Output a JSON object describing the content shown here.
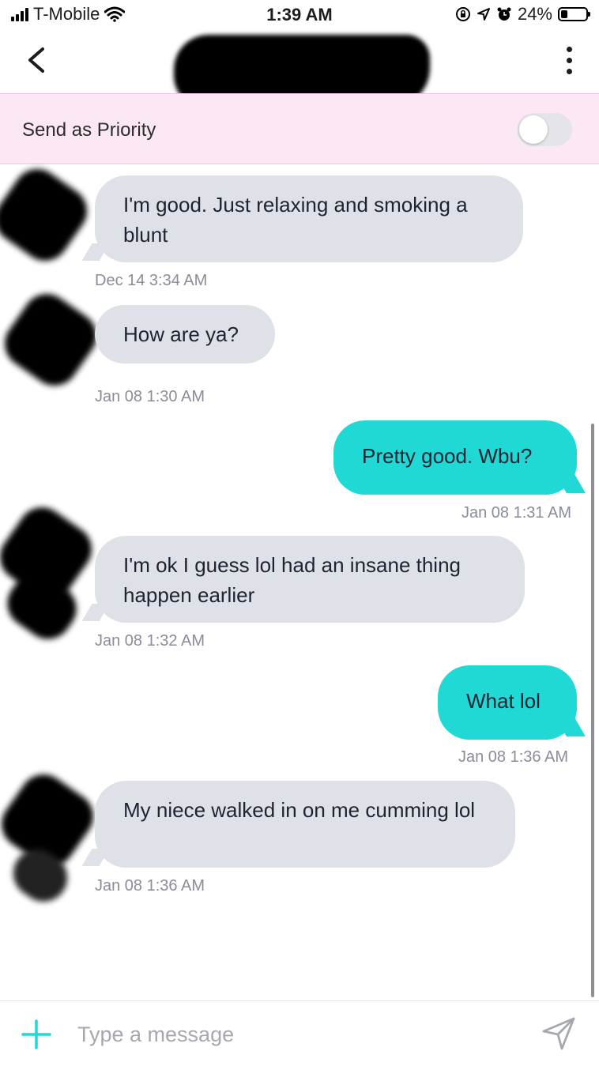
{
  "status_bar": {
    "carrier": "T-Mobile",
    "time": "1:39 AM",
    "battery": "24%",
    "icons": [
      "signal-icon",
      "wifi-icon",
      "rotation-lock-icon",
      "location-icon",
      "alarm-icon",
      "battery-icon"
    ]
  },
  "header": {
    "back_icon": "chevron-left-icon",
    "menu_icon": "more-vertical-icon"
  },
  "priority": {
    "label": "Send as Priority",
    "enabled": false
  },
  "messages": [
    {
      "direction": "in",
      "text": "I'm good.  Just relaxing and smoking a blunt",
      "time": "Dec 14 3:34 AM"
    },
    {
      "direction": "in",
      "text": "How are ya?",
      "time": "Jan 08 1:30 AM"
    },
    {
      "direction": "out",
      "text": "Pretty good. Wbu?",
      "time": "Jan 08 1:31 AM"
    },
    {
      "direction": "in",
      "text": "I'm ok I guess lol had an insane thing happen earlier",
      "time": "Jan 08 1:32 AM"
    },
    {
      "direction": "out",
      "text": "What lol",
      "time": "Jan 08 1:36 AM"
    },
    {
      "direction": "in",
      "text": "My niece walked in on me cumming lol",
      "time": "Jan 08 1:36 AM"
    }
  ],
  "composer": {
    "placeholder": "Type a message",
    "value": "",
    "add_icon": "plus-icon",
    "send_icon": "send-icon"
  },
  "colors": {
    "incoming_bubble": "#dfe1e8",
    "outgoing_bubble": "#20d8d4",
    "priority_bar": "#fce8f5",
    "accent": "#20d8d4"
  }
}
